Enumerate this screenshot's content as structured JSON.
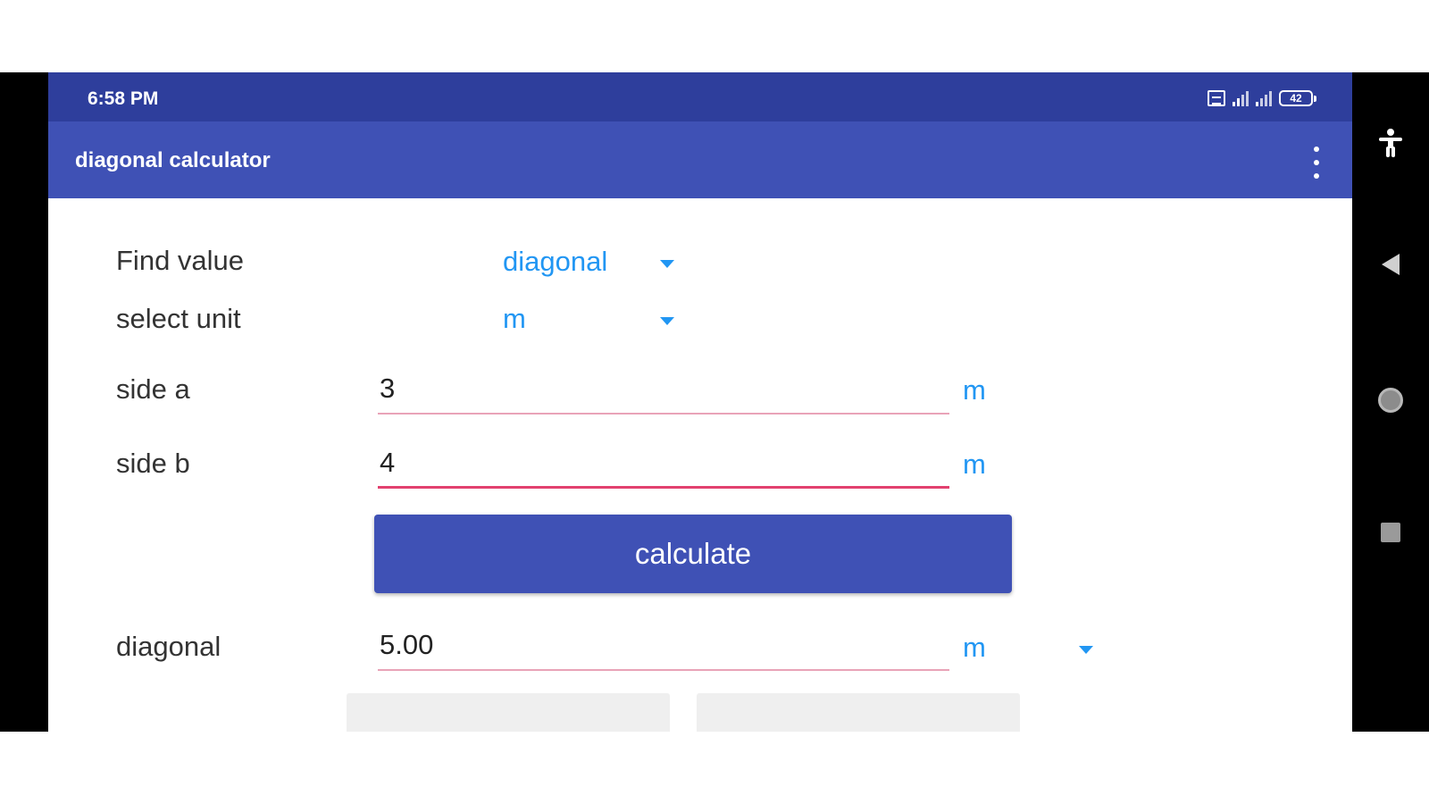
{
  "status_bar": {
    "time": "6:58 PM",
    "battery": "42",
    "icons": [
      "sim-icon",
      "signal-icon",
      "signal-icon",
      "battery-icon"
    ]
  },
  "app_bar": {
    "title": "diagonal calculator",
    "menu_icon": "more-vert-icon"
  },
  "form": {
    "find_value": {
      "label": "Find value",
      "selected": "diagonal"
    },
    "select_unit": {
      "label": "select unit",
      "selected": "m"
    },
    "side_a": {
      "label": "side a",
      "value": "3",
      "unit": "m"
    },
    "side_b": {
      "label": "side b",
      "value": "4",
      "unit": "m"
    },
    "calculate_label": "calculate",
    "result": {
      "label": "diagonal",
      "value": "5.00",
      "unit": "m"
    }
  },
  "nav_bar": {
    "icons": [
      "accessibility-icon",
      "back-icon",
      "home-icon",
      "recents-icon"
    ]
  },
  "colors": {
    "primary": "#3f51b5",
    "primary_dark": "#2e3e9c",
    "accent_blue": "#2196f3",
    "underline_pink": "#e2416f"
  }
}
